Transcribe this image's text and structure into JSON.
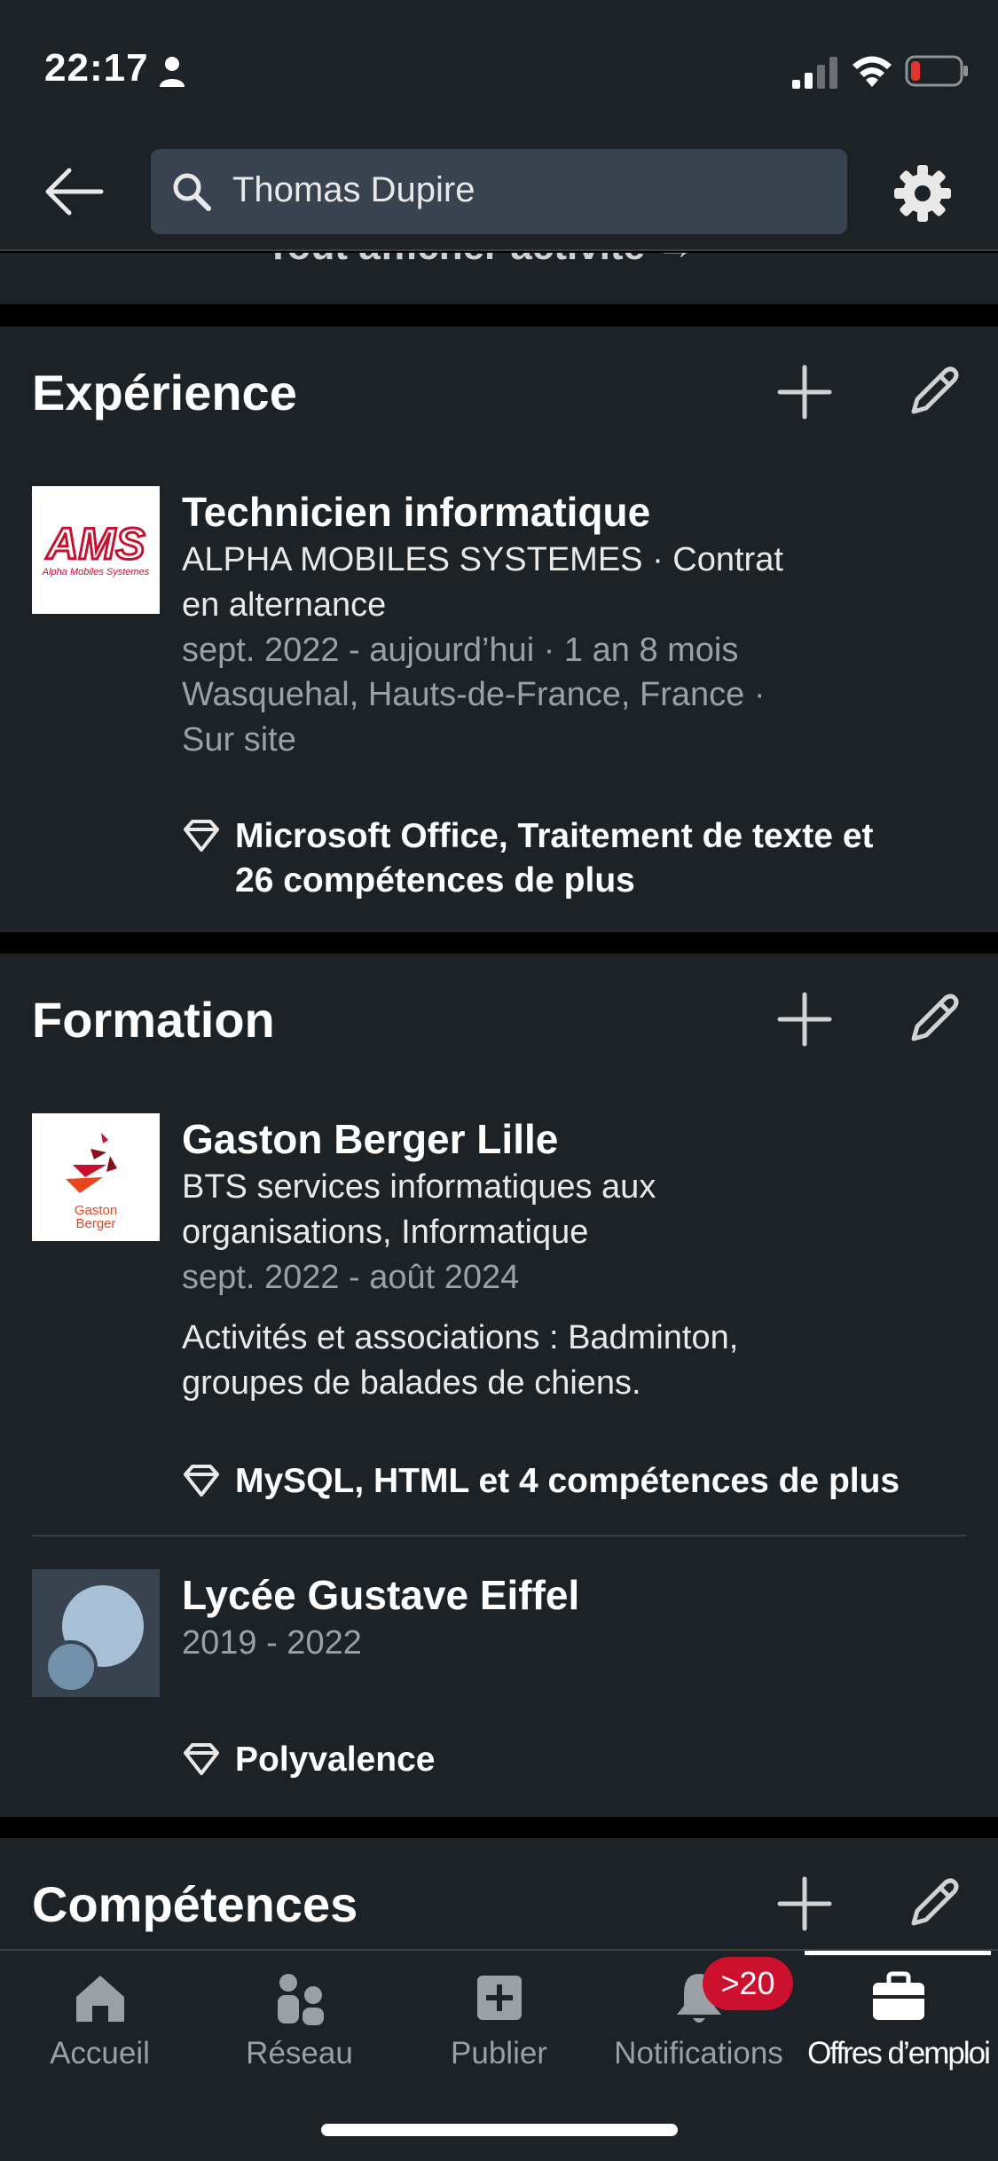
{
  "status_bar": {
    "time": "22:17",
    "icons": [
      "person-icon",
      "cellular-signal-icon",
      "wifi-icon",
      "battery-low-icon"
    ],
    "battery_color": "#e5322d"
  },
  "header": {
    "search_value": "Thomas Dupire",
    "icons": [
      "back-arrow-icon",
      "search-icon",
      "gear-icon"
    ]
  },
  "partial_text": "Tout afficher activité →",
  "experience": {
    "title": "Expérience",
    "entries": [
      {
        "logo": "AMS",
        "logo_caption": "Alpha Mobiles Systemes",
        "title": "Technicien informatique",
        "company_line1": "ALPHA MOBILES SYSTEMES · Contrat",
        "company_line2": "en alternance",
        "dates": "sept. 2022 - aujourd’hui · 1 an 8 mois",
        "location_line1": "Wasquehal, Hauts-de-France, France ·",
        "location_line2": "Sur site",
        "skills_line1": "Microsoft Office, Traitement de texte et",
        "skills_line2": "26 compétences de plus"
      }
    ]
  },
  "formation": {
    "title": "Formation",
    "entries": [
      {
        "logo_line1": "Gaston",
        "logo_line2": "Berger",
        "title": "Gaston Berger Lille",
        "degree_line1": "BTS services informatiques aux",
        "degree_line2": "organisations, Informatique",
        "dates": "sept. 2022 - août 2024",
        "activities_line1": "Activités et associations : Badminton,",
        "activities_line2": "groupes de balades de chiens.",
        "skills": "MySQL, HTML et 4 compétences de plus"
      },
      {
        "title": "Lycée Gustave Eiffel",
        "dates": "2019 - 2022",
        "skills": "Polyvalence"
      }
    ]
  },
  "competences": {
    "title": "Compétences"
  },
  "bottom_nav": {
    "items": [
      {
        "label": "Accueil",
        "icon": "home-icon"
      },
      {
        "label": "Réseau",
        "icon": "network-icon"
      },
      {
        "label": "Publier",
        "icon": "post-plus-icon"
      },
      {
        "label": "Notifications",
        "icon": "bell-icon"
      },
      {
        "label": "Offres d’emploi",
        "icon": "briefcase-icon"
      }
    ],
    "active_index": 4,
    "notification_badge": ">20"
  },
  "colors": {
    "background": "#1d2226",
    "separator": "#000000",
    "search_field": "#38434f",
    "text_secondary": "#9aa0a5",
    "badge": "#cb112d"
  }
}
